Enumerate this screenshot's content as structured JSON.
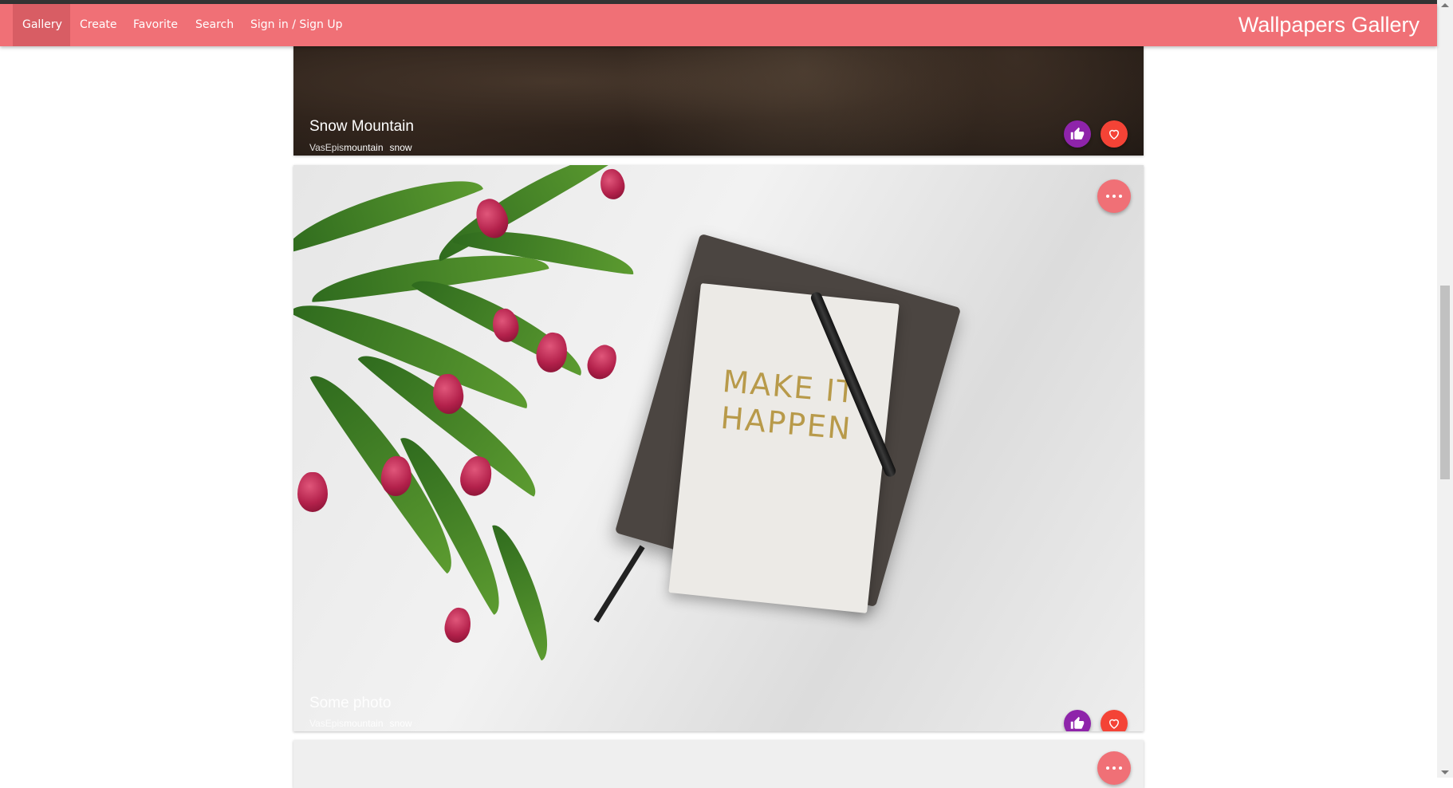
{
  "navbar": {
    "items": [
      {
        "label": "Gallery",
        "active": true
      },
      {
        "label": "Create",
        "active": false
      },
      {
        "label": "Favorite",
        "active": false
      },
      {
        "label": "Search",
        "active": false
      },
      {
        "label": "Sign in / Sign Up",
        "active": false
      }
    ],
    "brand": "Wallpapers Gallery"
  },
  "cards": [
    {
      "title": "Snow Mountain",
      "author": "VasEpis",
      "tags": [
        "mountain",
        "snow"
      ]
    },
    {
      "title": "Some photo",
      "author": "VasEpis",
      "tags": [
        "mountain",
        "snow"
      ],
      "image_text": "MAKE IT HAPPEN"
    }
  ],
  "colors": {
    "accent": "#f07076",
    "like": "#8e24aa",
    "favorite": "#f44336"
  },
  "icons": {
    "like": "thumbs-up-icon",
    "favorite": "heart-icon",
    "more": "more-horizontal-icon"
  }
}
